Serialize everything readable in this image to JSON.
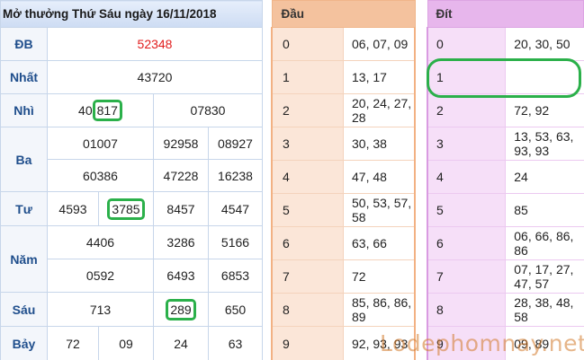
{
  "results": {
    "title": "Mở thưởng Thứ Sáu ngày 16/11/2018",
    "prizes": {
      "db": {
        "label": "ĐB",
        "values": [
          "52348"
        ]
      },
      "nhat": {
        "label": "Nhất",
        "values": [
          "43720"
        ]
      },
      "nhi": {
        "label": "Nhì",
        "values": [
          "40817",
          "07830"
        ]
      },
      "ba": {
        "label": "Ba",
        "values": [
          "01007",
          "92958",
          "08927",
          "60386",
          "47228",
          "16238"
        ]
      },
      "tu": {
        "label": "Tư",
        "values": [
          "4593",
          "3785",
          "8457",
          "4547"
        ]
      },
      "nam": {
        "label": "Năm",
        "values": [
          "4406",
          "3286",
          "5166",
          "0592",
          "6493",
          "6853"
        ]
      },
      "sau": {
        "label": "Sáu",
        "values": [
          "713",
          "289",
          "650"
        ]
      },
      "bay": {
        "label": "Bảy",
        "values": [
          "72",
          "09",
          "24",
          "63"
        ]
      }
    },
    "nhi_highlight": {
      "prefix": "40",
      "marked": "817"
    },
    "tu_highlight": {
      "prefix": "",
      "marked": "3785"
    },
    "sau_highlight": "289",
    "accent_red": "#e11d1d",
    "highlight_color": "#2bb04a"
  },
  "dau": {
    "header": "Đầu",
    "rows": [
      {
        "digit": "0",
        "values": "06, 07, 09"
      },
      {
        "digit": "1",
        "values": "13, 17"
      },
      {
        "digit": "2",
        "values": "20, 24, 27, 28"
      },
      {
        "digit": "3",
        "values": "30, 38"
      },
      {
        "digit": "4",
        "values": "47, 48"
      },
      {
        "digit": "5",
        "values": "50, 53, 57, 58"
      },
      {
        "digit": "6",
        "values": "63, 66"
      },
      {
        "digit": "7",
        "values": "72"
      },
      {
        "digit": "8",
        "values": "85, 86, 86, 89"
      },
      {
        "digit": "9",
        "values": "92, 93, 93"
      }
    ]
  },
  "dit": {
    "header": "Đít",
    "rows": [
      {
        "digit": "0",
        "values": "20, 30, 50"
      },
      {
        "digit": "1",
        "values": ""
      },
      {
        "digit": "2",
        "values": "72, 92"
      },
      {
        "digit": "3",
        "values": "13, 53, 63, 93, 93"
      },
      {
        "digit": "4",
        "values": "24"
      },
      {
        "digit": "5",
        "values": "85"
      },
      {
        "digit": "6",
        "values": "06, 66, 86, 86"
      },
      {
        "digit": "7",
        "values": "07, 17, 27, 47, 57"
      },
      {
        "digit": "8",
        "values": "28, 38, 48, 58"
      },
      {
        "digit": "9",
        "values": "09, 89"
      }
    ]
  },
  "watermark": "Lodephomnay.net"
}
